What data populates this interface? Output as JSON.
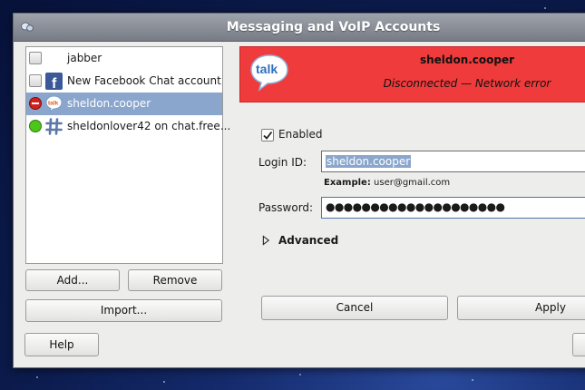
{
  "window": {
    "title": "Messaging and VoIP Accounts"
  },
  "accounts": [
    {
      "name": "jabber",
      "status": "offline",
      "protocol": "jabber-icon"
    },
    {
      "name": "New Facebook Chat account",
      "status": "offline",
      "protocol": "facebook-icon"
    },
    {
      "name": "sheldon.cooper",
      "status": "busy",
      "protocol": "gtalk-icon",
      "selected": true
    },
    {
      "name": "sheldonlover42 on chat.free...",
      "status": "online",
      "protocol": "irc-icon"
    }
  ],
  "list_buttons": {
    "add": "Add...",
    "remove": "Remove",
    "import": "Import...",
    "help": "Help"
  },
  "banner": {
    "logo_text": "talk",
    "account": "sheldon.cooper",
    "status_text": "Disconnected — Network error",
    "color": "#ef3b3b"
  },
  "form": {
    "enabled_label": "Enabled",
    "enabled": true,
    "login_label": "Login ID:",
    "login_value": "sheldon.cooper",
    "example_label": "Example:",
    "example_value": "user@gmail.com",
    "password_label": "Password:",
    "password_value": "●●●●●●●●●●●●●●●●●●●●",
    "advanced_label": "Advanced"
  },
  "actions": {
    "cancel": "Cancel",
    "apply": "Apply"
  },
  "colors": {
    "selection": "#8aa6cc",
    "titlebar": "#8a8f98",
    "selected_text_highlight": "#8aa6cc"
  }
}
